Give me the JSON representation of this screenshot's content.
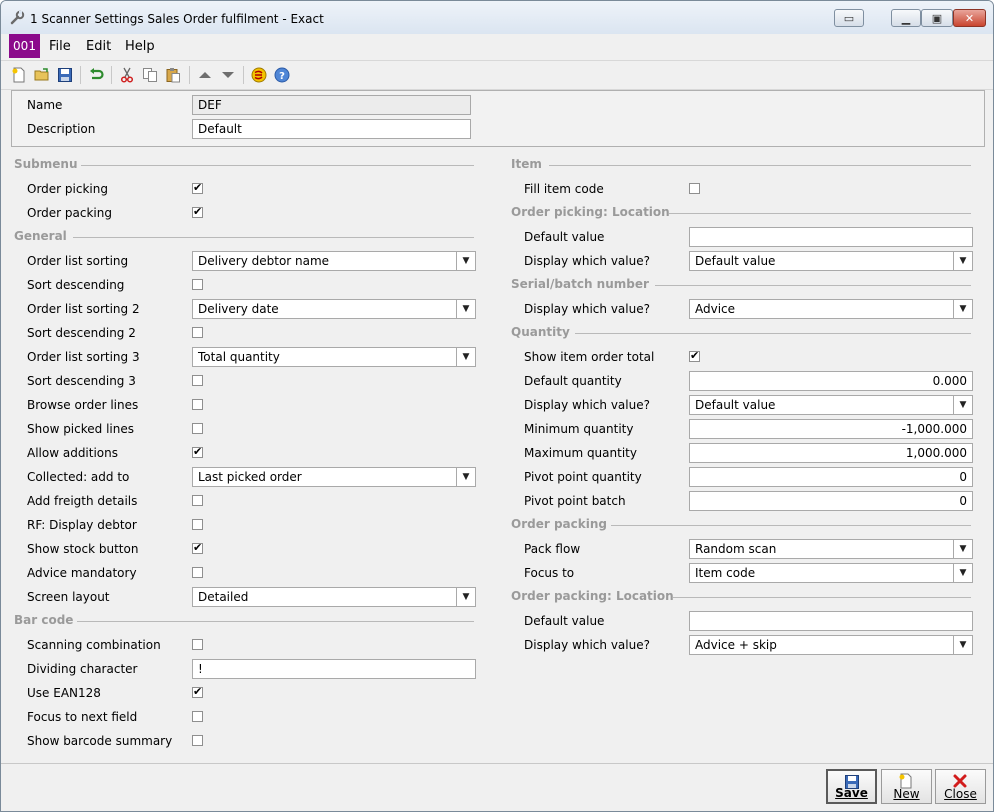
{
  "window": {
    "title": "1 Scanner Settings Sales Order fulfilment - Exact"
  },
  "menu": {
    "code": "001",
    "file": "File",
    "edit": "Edit",
    "help": "Help"
  },
  "header": {
    "name_label": "Name",
    "name_value": "DEF",
    "description_label": "Description",
    "description_value": "Default"
  },
  "submenu": {
    "title": "Submenu",
    "order_picking": {
      "label": "Order picking",
      "checked": true
    },
    "order_packing": {
      "label": "Order packing",
      "checked": true
    }
  },
  "general": {
    "title": "General",
    "order_list_sorting": {
      "label": "Order list sorting",
      "value": "Delivery debtor name"
    },
    "sort_descending": {
      "label": "Sort descending",
      "checked": false
    },
    "order_list_sorting_2": {
      "label": "Order list sorting 2",
      "value": "Delivery date"
    },
    "sort_descending_2": {
      "label": "Sort descending 2",
      "checked": false
    },
    "order_list_sorting_3": {
      "label": "Order list sorting 3",
      "value": "Total quantity"
    },
    "sort_descending_3": {
      "label": "Sort descending 3",
      "checked": false
    },
    "browse_order_lines": {
      "label": "Browse order lines",
      "checked": false
    },
    "show_picked_lines": {
      "label": "Show picked lines",
      "checked": false
    },
    "allow_additions": {
      "label": "Allow additions",
      "checked": true
    },
    "collected_add_to": {
      "label": "Collected: add to",
      "value": "Last picked order"
    },
    "add_freigth_details": {
      "label": "Add freigth details",
      "checked": false
    },
    "rf_display_debtor": {
      "label": "RF: Display debtor",
      "checked": false
    },
    "show_stock_button": {
      "label": "Show stock button",
      "checked": true
    },
    "advice_mandatory": {
      "label": "Advice mandatory",
      "checked": false
    },
    "screen_layout": {
      "label": "Screen layout",
      "value": "Detailed"
    }
  },
  "barcode": {
    "title": "Bar code",
    "scanning_combination": {
      "label": "Scanning combination",
      "checked": false
    },
    "dividing_character": {
      "label": "Dividing character",
      "value": "!"
    },
    "use_ean128": {
      "label": "Use EAN128",
      "checked": true
    },
    "focus_next_field": {
      "label": "Focus to next field",
      "checked": false
    },
    "show_barcode_summary": {
      "label": "Show barcode summary",
      "checked": false
    }
  },
  "item": {
    "title": "Item",
    "fill_item_code": {
      "label": "Fill item code",
      "checked": false
    }
  },
  "op_location": {
    "title": "Order picking: Location",
    "default_value": {
      "label": "Default value",
      "value": ""
    },
    "display_value": {
      "label": "Display which value?",
      "value": "Default value"
    }
  },
  "serial": {
    "title": "Serial/batch number",
    "display_value": {
      "label": "Display which value?",
      "value": "Advice"
    }
  },
  "quantity": {
    "title": "Quantity",
    "show_item_order_total": {
      "label": "Show item order total",
      "checked": true
    },
    "default_quantity": {
      "label": "Default quantity",
      "value": "0.000"
    },
    "display_value": {
      "label": "Display which value?",
      "value": "Default value"
    },
    "minimum_quantity": {
      "label": "Minimum quantity",
      "value": "-1,000.000"
    },
    "maximum_quantity": {
      "label": "Maximum quantity",
      "value": "1,000.000"
    },
    "pivot_point_quantity": {
      "label": "Pivot point quantity",
      "value": "0"
    },
    "pivot_point_batch": {
      "label": "Pivot point batch",
      "value": "0"
    }
  },
  "order_packing": {
    "title": "Order packing",
    "pack_flow": {
      "label": "Pack flow",
      "value": "Random scan"
    },
    "focus_to": {
      "label": "Focus to",
      "value": "Item code"
    }
  },
  "opk_location": {
    "title": "Order packing: Location",
    "default_value": {
      "label": "Default value",
      "value": ""
    },
    "display_value": {
      "label": "Display which value?",
      "value": "Advice + skip"
    }
  },
  "footer": {
    "save": "Save",
    "new": "New",
    "close": "Close"
  }
}
